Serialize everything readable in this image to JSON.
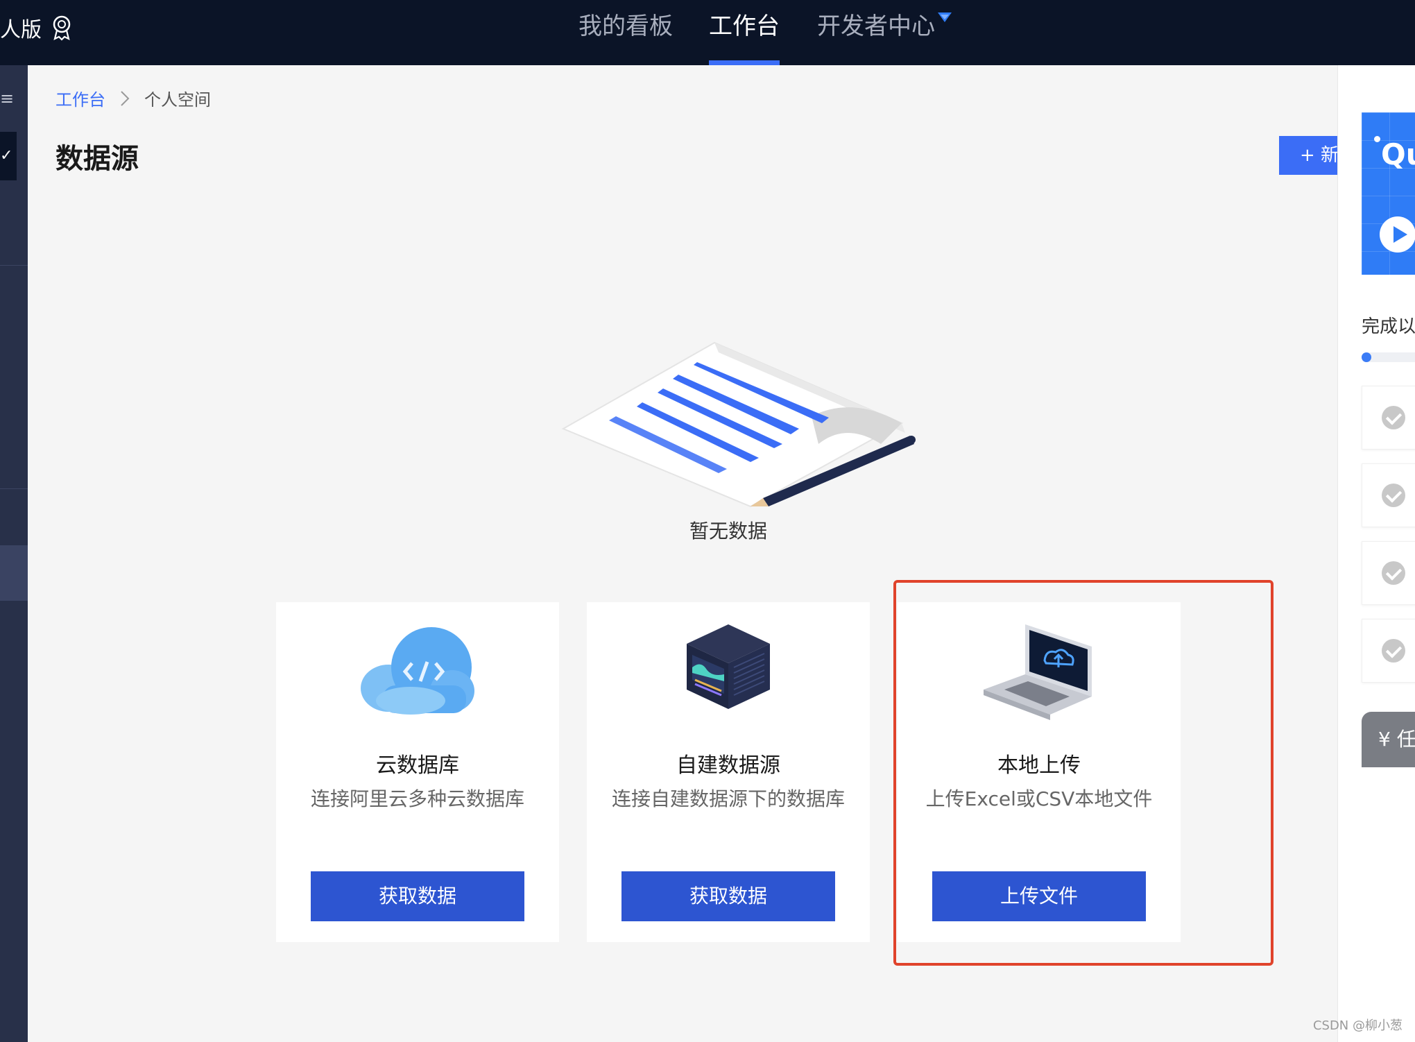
{
  "topbar": {
    "brand_text": "人版",
    "tabs": [
      {
        "label": "我的看板",
        "active": false
      },
      {
        "label": "工作台",
        "active": true
      },
      {
        "label": "开发者中心",
        "active": false
      }
    ]
  },
  "breadcrumb": {
    "root": "工作台",
    "current": "个人空间"
  },
  "page": {
    "title": "数据源",
    "new_button_label": "+ 新"
  },
  "empty_state": {
    "text": "暂无数据"
  },
  "cards": [
    {
      "title": "云数据库",
      "description": "连接阿里云多种云数据库",
      "button": "获取数据",
      "icon": "cloud-database-icon"
    },
    {
      "title": "自建数据源",
      "description": "连接自建数据源下的数据库",
      "button": "获取数据",
      "icon": "server-box-icon"
    },
    {
      "title": "本地上传",
      "description": "上传Excel或CSV本地文件",
      "button": "上传文件",
      "icon": "laptop-upload-icon"
    }
  ],
  "right_panel": {
    "promo_text": "Qu",
    "heading": "完成以",
    "progress": 0.12,
    "tasks_count_visible": 4,
    "bottom_button": "¥ 任"
  },
  "watermark": "CSDN @柳小葱",
  "colors": {
    "topbar_bg": "#0b1427",
    "accent_blue": "#3b6df6",
    "button_blue": "#2d55d1",
    "highlight_red": "#e0432b"
  }
}
